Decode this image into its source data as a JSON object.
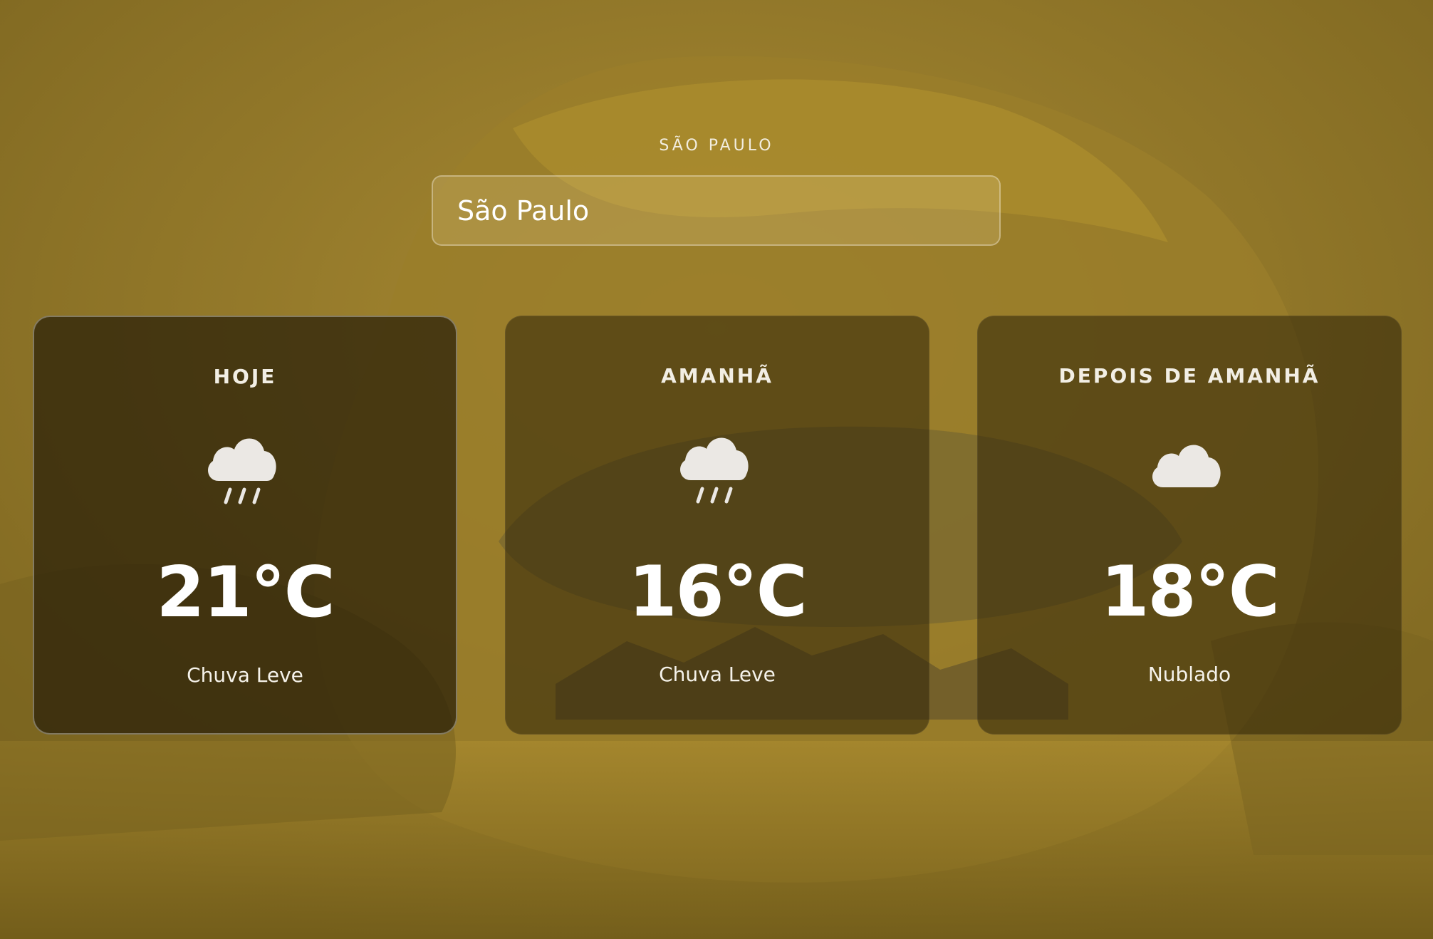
{
  "header": {
    "city_label": "SÃO PAULO"
  },
  "search": {
    "value": "São Paulo"
  },
  "forecast": [
    {
      "day": "HOJE",
      "temp": "21°C",
      "description": "Chuva Leve",
      "icon": "cloud-rain-icon"
    },
    {
      "day": "AMANHÃ",
      "temp": "16°C",
      "description": "Chuva Leve",
      "icon": "cloud-rain-icon"
    },
    {
      "day": "DEPOIS DE AMANHÃ",
      "temp": "18°C",
      "description": "Nublado",
      "icon": "cloud-icon"
    }
  ],
  "colors": {
    "background_tint": "#8f7628",
    "card_bg": "#2d2208",
    "icon_fill": "#ebe8e4"
  }
}
